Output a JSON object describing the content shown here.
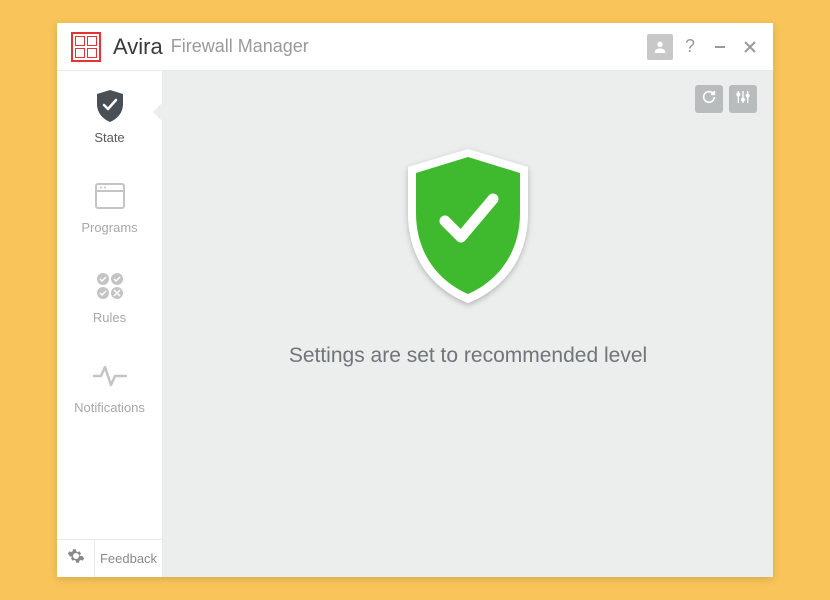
{
  "titlebar": {
    "brand": "Avira",
    "subtitle": "Firewall Manager"
  },
  "sidebar": {
    "items": [
      {
        "label": "State",
        "icon": "shield-check",
        "active": true
      },
      {
        "label": "Programs",
        "icon": "window",
        "active": false
      },
      {
        "label": "Rules",
        "icon": "rules",
        "active": false
      },
      {
        "label": "Notifications",
        "icon": "activity",
        "active": false
      }
    ],
    "footer": {
      "feedback": "Feedback"
    }
  },
  "content": {
    "status_text": "Settings are set to recommended level",
    "shield_color": "#3fba2f"
  }
}
